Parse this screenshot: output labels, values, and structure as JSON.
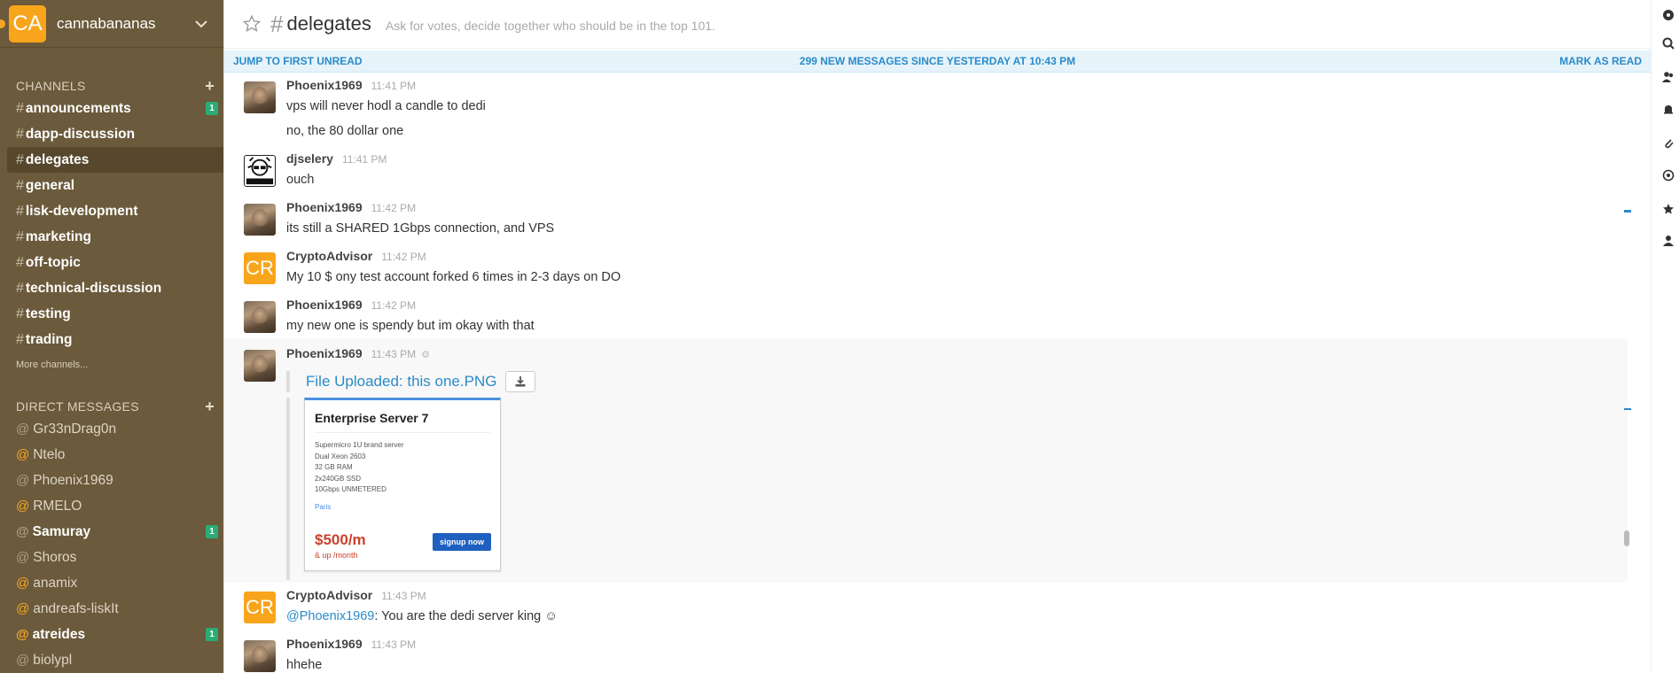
{
  "team": {
    "initials": "CA",
    "name": "cannabananas"
  },
  "sidebar": {
    "channels_heading": "CHANNELS",
    "channels": [
      {
        "name": "announcements",
        "badge": "1"
      },
      {
        "name": "dapp-discussion",
        "badge": ""
      },
      {
        "name": "delegates",
        "badge": "",
        "active": true
      },
      {
        "name": "general",
        "badge": ""
      },
      {
        "name": "lisk-development",
        "badge": ""
      },
      {
        "name": "marketing",
        "badge": ""
      },
      {
        "name": "off-topic",
        "badge": ""
      },
      {
        "name": "technical-discussion",
        "badge": ""
      },
      {
        "name": "testing",
        "badge": ""
      },
      {
        "name": "trading",
        "badge": ""
      }
    ],
    "more_channels": "More channels...",
    "dm_heading": "DIRECT MESSAGES",
    "dms": [
      {
        "name": "Gr33nDrag0n",
        "status": "away",
        "badge": ""
      },
      {
        "name": "Ntelo",
        "status": "online",
        "badge": ""
      },
      {
        "name": "Phoenix1969",
        "status": "away",
        "badge": ""
      },
      {
        "name": "RMELO",
        "status": "online",
        "badge": ""
      },
      {
        "name": "Samuray",
        "status": "away",
        "badge": "1"
      },
      {
        "name": "Shoros",
        "status": "away",
        "badge": ""
      },
      {
        "name": "anamix",
        "status": "online",
        "badge": ""
      },
      {
        "name": "andreafs-liskIt",
        "status": "online",
        "badge": ""
      },
      {
        "name": "atreides",
        "status": "online",
        "badge": "1"
      },
      {
        "name": "biolypl",
        "status": "away",
        "badge": ""
      }
    ]
  },
  "channel": {
    "hash": "#",
    "name": "delegates",
    "topic": "Ask for votes, decide together who should be in the top 101."
  },
  "unread_bar": {
    "left": "JUMP TO FIRST UNREAD",
    "center": "299 NEW MESSAGES SINCE YESTERDAY AT 10:43 PM",
    "right": "MARK AS READ"
  },
  "messages": {
    "m1": {
      "author": "Phoenix1969",
      "time": "11:41 PM",
      "lines": [
        "vps will never hodl a candle to dedi",
        "no, the 80 dollar one"
      ]
    },
    "m2": {
      "author": "djselery",
      "time": "11:41 PM",
      "text": "ouch"
    },
    "m3": {
      "author": "Phoenix1969",
      "time": "11:42 PM",
      "text": "its still a SHARED 1Gbps connection, and VPS"
    },
    "m4": {
      "author": "CryptoAdvisor",
      "initials": "CR",
      "time": "11:42 PM",
      "text": "My 10 $ ony test account forked 6 times in 2-3 days on DO"
    },
    "m5": {
      "author": "Phoenix1969",
      "time": "11:42 PM",
      "text": "my new one is spendy but im okay with that"
    },
    "m6": {
      "author": "Phoenix1969",
      "time": "11:43 PM",
      "file_link": "File Uploaded: this one.PNG",
      "card": {
        "title": "Enterprise Server 7",
        "specs": [
          "Supermicro 1U brand server",
          "Dual Xeon 2603",
          "32 GB RAM",
          "2x240GB SSD",
          "10Gbps UNMETERED"
        ],
        "location": "Paris",
        "price": "$500/m",
        "per": "& up /month",
        "button": "signup now"
      }
    },
    "m7": {
      "author": "CryptoAdvisor",
      "initials": "CR",
      "time": "11:43 PM",
      "mention": "@Phoenix1969",
      "text": ": You are the dedi server king ☺"
    },
    "m8": {
      "author": "Phoenix1969",
      "time": "11:43 PM",
      "text": "hhehe"
    }
  },
  "colors": {
    "sidebar": "#6b5a3b",
    "accent": "#2a8bc8",
    "team_avatar": "#f8a51c",
    "badge": "#2bac76"
  },
  "icons": [
    "star-icon",
    "chevron-down-icon",
    "download-icon",
    "gear-icon",
    "plus-icon"
  ]
}
